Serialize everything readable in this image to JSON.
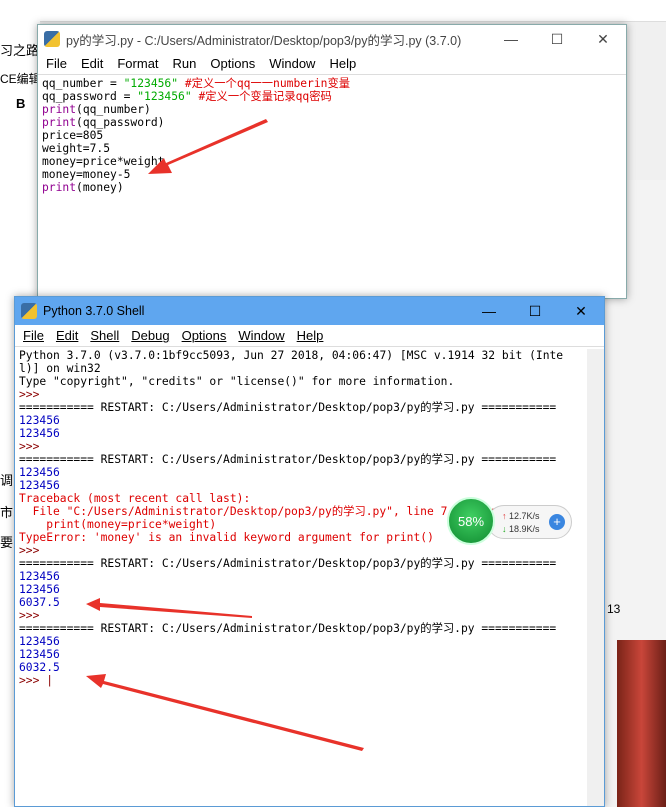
{
  "background": {
    "left_texts": [
      "习之路",
      "CE编辑",
      "B",
      "调",
      "市",
      "要"
    ],
    "right_number": "13"
  },
  "editor": {
    "title": "py的学习.py - C:/Users/Administrator/Desktop/pop3/py的学习.py (3.7.0)",
    "menu": [
      "File",
      "Edit",
      "Format",
      "Run",
      "Options",
      "Window",
      "Help"
    ],
    "lines": [
      [
        {
          "t": "qq_number = ",
          "c": ""
        },
        {
          "t": "\"123456\"",
          "c": "str"
        },
        {
          "t": " #定义一个qq一一numberin变量",
          "c": "cm"
        }
      ],
      [
        {
          "t": "qq_password = ",
          "c": ""
        },
        {
          "t": "\"123456\"",
          "c": "str"
        },
        {
          "t": " #定义一个变量记录qq密码",
          "c": "cm"
        }
      ],
      [
        {
          "t": "print",
          "c": "kw"
        },
        {
          "t": "(qq_number)",
          "c": ""
        }
      ],
      [
        {
          "t": "print",
          "c": "kw"
        },
        {
          "t": "(qq_password)",
          "c": ""
        }
      ],
      [
        {
          "t": "price=805",
          "c": ""
        }
      ],
      [
        {
          "t": "weight=7.5",
          "c": ""
        }
      ],
      [
        {
          "t": "money=price*weight",
          "c": ""
        }
      ],
      [
        {
          "t": "money=money-5",
          "c": ""
        }
      ],
      [
        {
          "t": "print",
          "c": "kw"
        },
        {
          "t": "(money)",
          "c": ""
        }
      ]
    ]
  },
  "shell": {
    "title": "Python 3.7.0 Shell",
    "menu": [
      "File",
      "Edit",
      "Shell",
      "Debug",
      "Options",
      "Window",
      "Help"
    ],
    "lines": [
      {
        "t": "Python 3.7.0 (v3.7.0:1bf9cc5093, Jun 27 2018, 04:06:47) [MSC v.1914 32 bit (Inte",
        "c": ""
      },
      {
        "t": "l)] on win32",
        "c": ""
      },
      {
        "t": "Type \"copyright\", \"credits\" or \"license()\" for more information.",
        "c": ""
      },
      {
        "t": ">>> ",
        "c": "pr"
      },
      {
        "t": "=========== RESTART: C:/Users/Administrator/Desktop/pop3/py的学习.py ===========",
        "c": ""
      },
      {
        "t": "123456",
        "c": "out"
      },
      {
        "t": "123456",
        "c": "out"
      },
      {
        "t": ">>> ",
        "c": "pr"
      },
      {
        "t": "=========== RESTART: C:/Users/Administrator/Desktop/pop3/py的学习.py ===========",
        "c": ""
      },
      {
        "t": "123456",
        "c": "out"
      },
      {
        "t": "123456",
        "c": "out"
      },
      {
        "t": "Traceback (most recent call last):",
        "c": "err"
      },
      {
        "t": "  File \"C:/Users/Administrator/Desktop/pop3/py的学习.py\", line 7, in <module>",
        "c": "err"
      },
      {
        "t": "    print(money=price*weight)",
        "c": "err"
      },
      {
        "t": "TypeError: 'money' is an invalid keyword argument for print()",
        "c": "err"
      },
      {
        "t": ">>> ",
        "c": "pr"
      },
      {
        "t": "=========== RESTART: C:/Users/Administrator/Desktop/pop3/py的学习.py ===========",
        "c": ""
      },
      {
        "t": "123456",
        "c": "out"
      },
      {
        "t": "123456",
        "c": "out"
      },
      {
        "t": "6037.5",
        "c": "out"
      },
      {
        "t": ">>> ",
        "c": "pr"
      },
      {
        "t": "=========== RESTART: C:/Users/Administrator/Desktop/pop3/py的学习.py ===========",
        "c": ""
      },
      {
        "t": "123456",
        "c": "out"
      },
      {
        "t": "123456",
        "c": "out"
      },
      {
        "t": "6032.5",
        "c": "out"
      },
      {
        "t": ">>> |",
        "c": "pr"
      }
    ]
  },
  "net_widget": {
    "cpu": "58%",
    "upload": "12.7K/s",
    "download": "18.9K/s",
    "plus": "+"
  },
  "window_controls": {
    "min": "—",
    "max": "☐",
    "close": "✕"
  }
}
